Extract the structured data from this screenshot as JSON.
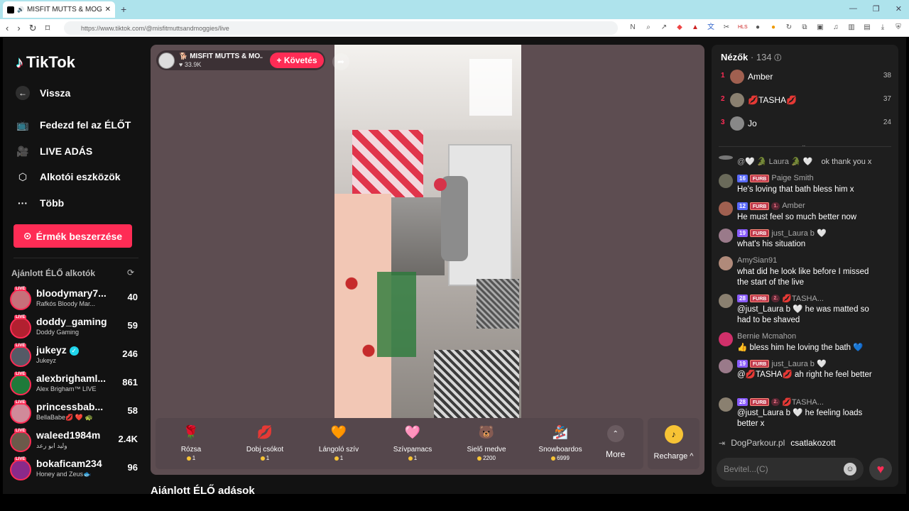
{
  "browser": {
    "tab_title": "MISFIT MUTTS & MOGGIE",
    "tab_close": "✕",
    "new_tab": "+",
    "url": "https://www.tiktok.com/@misfitmuttsandmoggies/live"
  },
  "sidebar": {
    "logo": "TikTok",
    "back": "Vissza",
    "nav": [
      {
        "label": "Fedezd fel az ÉLŐT",
        "icon": "live-tv-icon"
      },
      {
        "label": "LIVE ADÁS",
        "icon": "camera-icon"
      },
      {
        "label": "Alkotói eszközök",
        "icon": "creator-tools-icon"
      },
      {
        "label": "Több",
        "icon": "more-dots-icon"
      }
    ],
    "coins_button": "Érmék beszerzése",
    "recommended_title": "Ajánlott ÉLŐ alkotók",
    "creators": [
      {
        "name": "bloodymary7...",
        "sub": "Rafkós Bloody Mar...",
        "count": "40",
        "color": "#c7707a"
      },
      {
        "name": "doddy_gaming",
        "sub": "Doddy Gaming",
        "count": "59",
        "color": "#b22030"
      },
      {
        "name": "jukeyz",
        "sub": "Jukeyz",
        "count": "246",
        "color": "#555a66",
        "verified": true
      },
      {
        "name": "alexbrighaml...",
        "sub": "Alex Brigham™ LIVE",
        "count": "861",
        "color": "#1f7a3a"
      },
      {
        "name": "princessbab...",
        "sub": "BellaBabe💋 ❤️ 🐢",
        "count": "58",
        "color": "#d08a9a"
      },
      {
        "name": "waleed1984m",
        "sub": "وليد ابو رعد",
        "count": "2.4K",
        "color": "#6b5a4a"
      },
      {
        "name": "bokaficam234",
        "sub": "Honey and Zeus🐟",
        "count": "96",
        "color": "#8a2a8a"
      }
    ]
  },
  "player": {
    "host_name": "🐕 MISFIT MUTTS & MO...",
    "host_likes": "♥ 33.9K",
    "follow": "+ Követés",
    "gifts": [
      {
        "name": "Rózsa",
        "price": "1",
        "icon": "🌹"
      },
      {
        "name": "Dobj csókot",
        "price": "1",
        "icon": "💋"
      },
      {
        "name": "Lángoló szív",
        "price": "1",
        "icon": "🧡"
      },
      {
        "name": "Szívpamacs",
        "price": "1",
        "icon": "🩷"
      },
      {
        "name": "Sielő medve",
        "price": "2200",
        "icon": "🐻"
      },
      {
        "name": "Snowboardos",
        "price": "6999",
        "icon": "🏂"
      }
    ],
    "more": "More",
    "recharge": "Recharge ^"
  },
  "section_title": "Ajánlott ÉLŐ adások",
  "chat": {
    "viewers_label": "Nézők",
    "viewers_count": "· 134",
    "top_viewers": [
      {
        "rank": "1",
        "name": "Amber",
        "score": "38",
        "color": "#a06050"
      },
      {
        "rank": "2",
        "name": "💋TASHA💋",
        "score": "37",
        "color": "#8a8070"
      },
      {
        "rank": "3",
        "name": "Jo",
        "score": "24",
        "color": "#888"
      }
    ],
    "messages": [
      {
        "user": "@🤍 🐊 Laura 🐊 🤍",
        "badges": [],
        "text": "ok thank you x",
        "inline": true,
        "color": "#777"
      },
      {
        "user": "Paige Smith",
        "badges": [
          "16",
          "FURB"
        ],
        "text": "He's loving that bath bless him x",
        "color": "#6a6a5a"
      },
      {
        "user": "Amber",
        "badges": [
          "12",
          "FURB",
          "1."
        ],
        "text": "He must feel so much better now",
        "color": "#a06050"
      },
      {
        "user": "just_Laura b 🤍",
        "badges": [
          "19",
          "FURB"
        ],
        "text": "what's his situation",
        "color": "#9a7a8a"
      },
      {
        "user": "AmySian91",
        "badges": [],
        "text": "what did he look like before I missed the start of the live",
        "color": "#b08a7a"
      },
      {
        "user": "💋TASHA...",
        "badges": [
          "28",
          "FURB",
          "2."
        ],
        "text": "@just_Laura b 🤍 he was matted so had to be shaved",
        "color": "#8a8070"
      },
      {
        "user": "Bernie Mcmahon",
        "badges": [],
        "text": "👍 bless him he loving the bath 💙",
        "color": "#d0306a"
      },
      {
        "user": "just_Laura b 🤍",
        "badges": [
          "19",
          "FURB"
        ],
        "text": "@💋TASHA💋 ah right he feel better",
        "color": "#9a7a8a"
      },
      {
        "user": "💋TASHA...",
        "badges": [
          "28",
          "FURB",
          "2."
        ],
        "text": "@just_Laura b 🤍 he feeling loads better x",
        "color": "#8a8070"
      }
    ],
    "join_user": "DogParkour.pl",
    "join_text": "csatlakozott",
    "input_placeholder": "Bevitel...(C)"
  }
}
